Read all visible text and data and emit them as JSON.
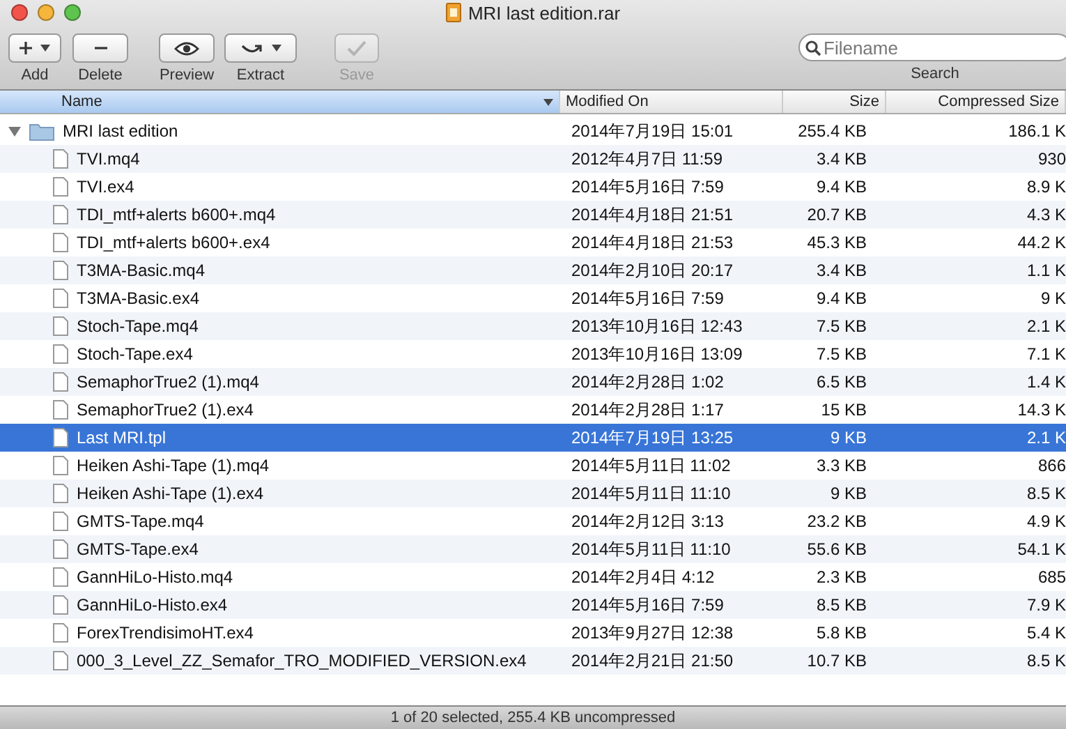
{
  "window": {
    "title": "MRI last edition.rar"
  },
  "toolbar": [
    {
      "kind": "add",
      "label": "Add",
      "disabled": false
    },
    {
      "kind": "delete",
      "label": "Delete",
      "disabled": false
    },
    {
      "kind": "preview",
      "label": "Preview",
      "disabled": false
    },
    {
      "kind": "extract",
      "label": "Extract",
      "disabled": false
    },
    {
      "kind": "save",
      "label": "Save",
      "disabled": true
    }
  ],
  "search": {
    "placeholder": "Filename",
    "label": "Search"
  },
  "columns": [
    {
      "label": "Name",
      "sorted": true
    },
    {
      "label": "Modified On",
      "sorted": false
    },
    {
      "label": "Size",
      "sorted": false
    },
    {
      "label": "Compressed Size",
      "sorted": false
    }
  ],
  "tree": [
    {
      "name": "MRI last edition",
      "kind": "folder",
      "expanded": true,
      "selected": false,
      "modified": "2014年7月19日 15:01",
      "size": "255.4 KB",
      "compressed": "186.1 K",
      "children": [
        {
          "name": "TVI.mq4",
          "kind": "file",
          "selected": false,
          "modified": "2012年4月7日 11:59",
          "size": "3.4 KB",
          "compressed": "930"
        },
        {
          "name": "TVI.ex4",
          "kind": "file",
          "selected": false,
          "modified": "2014年5月16日 7:59",
          "size": "9.4 KB",
          "compressed": "8.9 K"
        },
        {
          "name": "TDI_mtf+alerts b600+.mq4",
          "kind": "file",
          "selected": false,
          "modified": "2014年4月18日 21:51",
          "size": "20.7 KB",
          "compressed": "4.3 K"
        },
        {
          "name": "TDI_mtf+alerts b600+.ex4",
          "kind": "file",
          "selected": false,
          "modified": "2014年4月18日 21:53",
          "size": "45.3 KB",
          "compressed": "44.2 K"
        },
        {
          "name": "T3MA-Basic.mq4",
          "kind": "file",
          "selected": false,
          "modified": "2014年2月10日 20:17",
          "size": "3.4 KB",
          "compressed": "1.1 K"
        },
        {
          "name": "T3MA-Basic.ex4",
          "kind": "file",
          "selected": false,
          "modified": "2014年5月16日 7:59",
          "size": "9.4 KB",
          "compressed": "9 K"
        },
        {
          "name": "Stoch-Tape.mq4",
          "kind": "file",
          "selected": false,
          "modified": "2013年10月16日 12:43",
          "size": "7.5 KB",
          "compressed": "2.1 K"
        },
        {
          "name": "Stoch-Tape.ex4",
          "kind": "file",
          "selected": false,
          "modified": "2013年10月16日 13:09",
          "size": "7.5 KB",
          "compressed": "7.1 K"
        },
        {
          "name": "SemaphorTrue2 (1).mq4",
          "kind": "file",
          "selected": false,
          "modified": "2014年2月28日 1:02",
          "size": "6.5 KB",
          "compressed": "1.4 K"
        },
        {
          "name": "SemaphorTrue2 (1).ex4",
          "kind": "file",
          "selected": false,
          "modified": "2014年2月28日 1:17",
          "size": "15 KB",
          "compressed": "14.3 K"
        },
        {
          "name": "Last MRI.tpl",
          "kind": "file",
          "selected": true,
          "modified": "2014年7月19日 13:25",
          "size": "9 KB",
          "compressed": "2.1 K"
        },
        {
          "name": "Heiken Ashi-Tape (1).mq4",
          "kind": "file",
          "selected": false,
          "modified": "2014年5月11日 11:02",
          "size": "3.3 KB",
          "compressed": "866"
        },
        {
          "name": "Heiken Ashi-Tape (1).ex4",
          "kind": "file",
          "selected": false,
          "modified": "2014年5月11日 11:10",
          "size": "9 KB",
          "compressed": "8.5 K"
        },
        {
          "name": "GMTS-Tape.mq4",
          "kind": "file",
          "selected": false,
          "modified": "2014年2月12日 3:13",
          "size": "23.2 KB",
          "compressed": "4.9 K"
        },
        {
          "name": "GMTS-Tape.ex4",
          "kind": "file",
          "selected": false,
          "modified": "2014年5月11日 11:10",
          "size": "55.6 KB",
          "compressed": "54.1 K"
        },
        {
          "name": "GannHiLo-Histo.mq4",
          "kind": "file",
          "selected": false,
          "modified": "2014年2月4日 4:12",
          "size": "2.3 KB",
          "compressed": "685"
        },
        {
          "name": "GannHiLo-Histo.ex4",
          "kind": "file",
          "selected": false,
          "modified": "2014年5月16日 7:59",
          "size": "8.5 KB",
          "compressed": "7.9 K"
        },
        {
          "name": "ForexTrendisimoHT.ex4",
          "kind": "file",
          "selected": false,
          "modified": "2013年9月27日 12:38",
          "size": "5.8 KB",
          "compressed": "5.4 K"
        },
        {
          "name": "000_3_Level_ZZ_Semafor_TRO_MODIFIED_VERSION.ex4",
          "kind": "file",
          "selected": false,
          "modified": "2014年2月21日 21:50",
          "size": "10.7 KB",
          "compressed": "8.5 K"
        }
      ]
    }
  ],
  "status_bar": "1 of 20 selected, 255.4 KB uncompressed"
}
